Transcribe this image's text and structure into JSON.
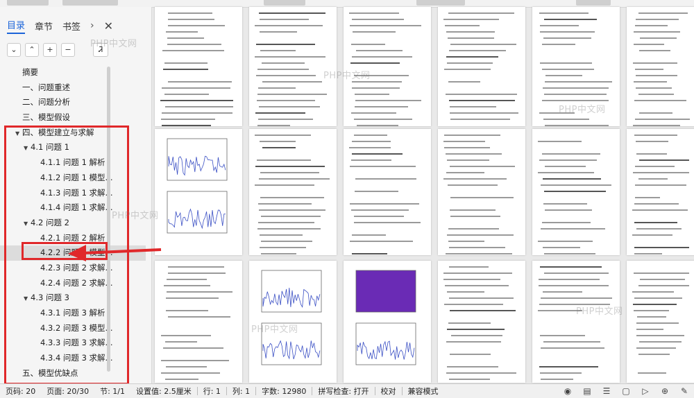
{
  "sidebar": {
    "tabs": [
      "目录",
      "章节",
      "书签"
    ],
    "toc": [
      {
        "label": "摘要",
        "level": 0,
        "expandable": false
      },
      {
        "label": "一、问题重述",
        "level": 0,
        "expandable": false
      },
      {
        "label": "二、问题分析",
        "level": 0,
        "expandable": false
      },
      {
        "label": "三、模型假设",
        "level": 0,
        "expandable": false
      },
      {
        "label": "四、模型建立与求解",
        "level": 0,
        "expandable": true
      },
      {
        "label": "4.1 问题 1",
        "level": 1,
        "expandable": true
      },
      {
        "label": "4.1.1 问题 1 解析",
        "level": 2,
        "expandable": false
      },
      {
        "label": "4.1.2 问题 1 模型...",
        "level": 2,
        "expandable": false
      },
      {
        "label": "4.1.3 问题 1 求解...",
        "level": 2,
        "expandable": false
      },
      {
        "label": "4.1.4 问题 1 求解...",
        "level": 2,
        "expandable": false
      },
      {
        "label": "4.2 问题 2",
        "level": 1,
        "expandable": true
      },
      {
        "label": "4.2.1 问题 2 解析",
        "level": 2,
        "expandable": false
      },
      {
        "label": "4.2.2 问题 2 模型...",
        "level": 2,
        "expandable": false,
        "selected": true
      },
      {
        "label": "4.2.3 问题 2 求解...",
        "level": 2,
        "expandable": false
      },
      {
        "label": "4.2.4 问题 2 求解...",
        "level": 2,
        "expandable": false
      },
      {
        "label": "4.3 问题 3",
        "level": 1,
        "expandable": true
      },
      {
        "label": "4.3.1 问题 3 解析",
        "level": 2,
        "expandable": false
      },
      {
        "label": "4.3.2 问题 3 模型...",
        "level": 2,
        "expandable": false
      },
      {
        "label": "4.3.3 问题 3 求解...",
        "level": 2,
        "expandable": false
      },
      {
        "label": "4.3.4 问题 3 求解...",
        "level": 2,
        "expandable": false
      },
      {
        "label": "五、模型优缺点",
        "level": 0,
        "expandable": false
      }
    ]
  },
  "watermark": "PHP中文网",
  "status": {
    "page": "页码: 20",
    "pages": "页面: 20/30",
    "section": "节: 1/1",
    "setting": "设置值: 2.5厘米",
    "row": "行: 1",
    "col": "列: 1",
    "words": "字数: 12980",
    "spell": "拼写检查: 打开",
    "proof": "校对",
    "compat": "兼容模式"
  },
  "colors": {
    "annotation": "#e0282a",
    "active_tab": "#1b64d9"
  }
}
